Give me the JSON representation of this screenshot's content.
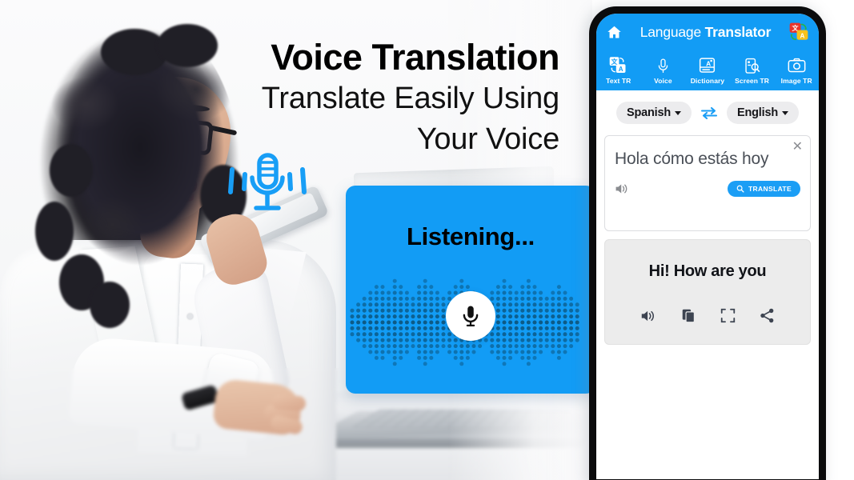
{
  "promo": {
    "headline_main": "Voice Translation",
    "headline_sub_line1": "Translate Easily Using",
    "headline_sub_line2": "Your Voice",
    "mic_decor_icon": "microphone-with-soundwaves-icon"
  },
  "listening_card": {
    "title": "Listening...",
    "mic_icon": "microphone-icon",
    "bg_color": "#129cf5",
    "wave_dot_color": "#0d5a86"
  },
  "phone_app": {
    "header": {
      "home_icon": "home-icon",
      "title_light": "Language ",
      "title_bold": "Translator",
      "logo_icon": "translate-bubbles-logo-icon",
      "bg_color": "#129cf5"
    },
    "tabs": [
      {
        "label": "Text TR",
        "icon": "translate-text-icon",
        "active": true
      },
      {
        "label": "Voice",
        "icon": "microphone-icon",
        "active": false
      },
      {
        "label": "Dictionary",
        "icon": "dictionary-book-icon",
        "active": false
      },
      {
        "label": "Screen TR",
        "icon": "screen-search-icon",
        "active": false
      },
      {
        "label": "Image TR",
        "icon": "camera-icon",
        "active": false
      }
    ],
    "language_selector": {
      "source_language": "Spanish",
      "target_language": "English",
      "swap_icon": "swap-arrows-icon"
    },
    "input_card": {
      "text": "Hola cómo estás hoy",
      "close_icon": "close-icon",
      "speaker_icon": "speaker-icon",
      "translate_button_label": "TRANSLATE",
      "translate_button_icon": "search-icon",
      "translate_button_color": "#1b9ef5"
    },
    "output_card": {
      "text": "Hi! How are you",
      "actions": [
        {
          "icon": "speaker-icon"
        },
        {
          "icon": "copy-icon"
        },
        {
          "icon": "fullscreen-icon"
        },
        {
          "icon": "share-icon"
        }
      ]
    }
  }
}
